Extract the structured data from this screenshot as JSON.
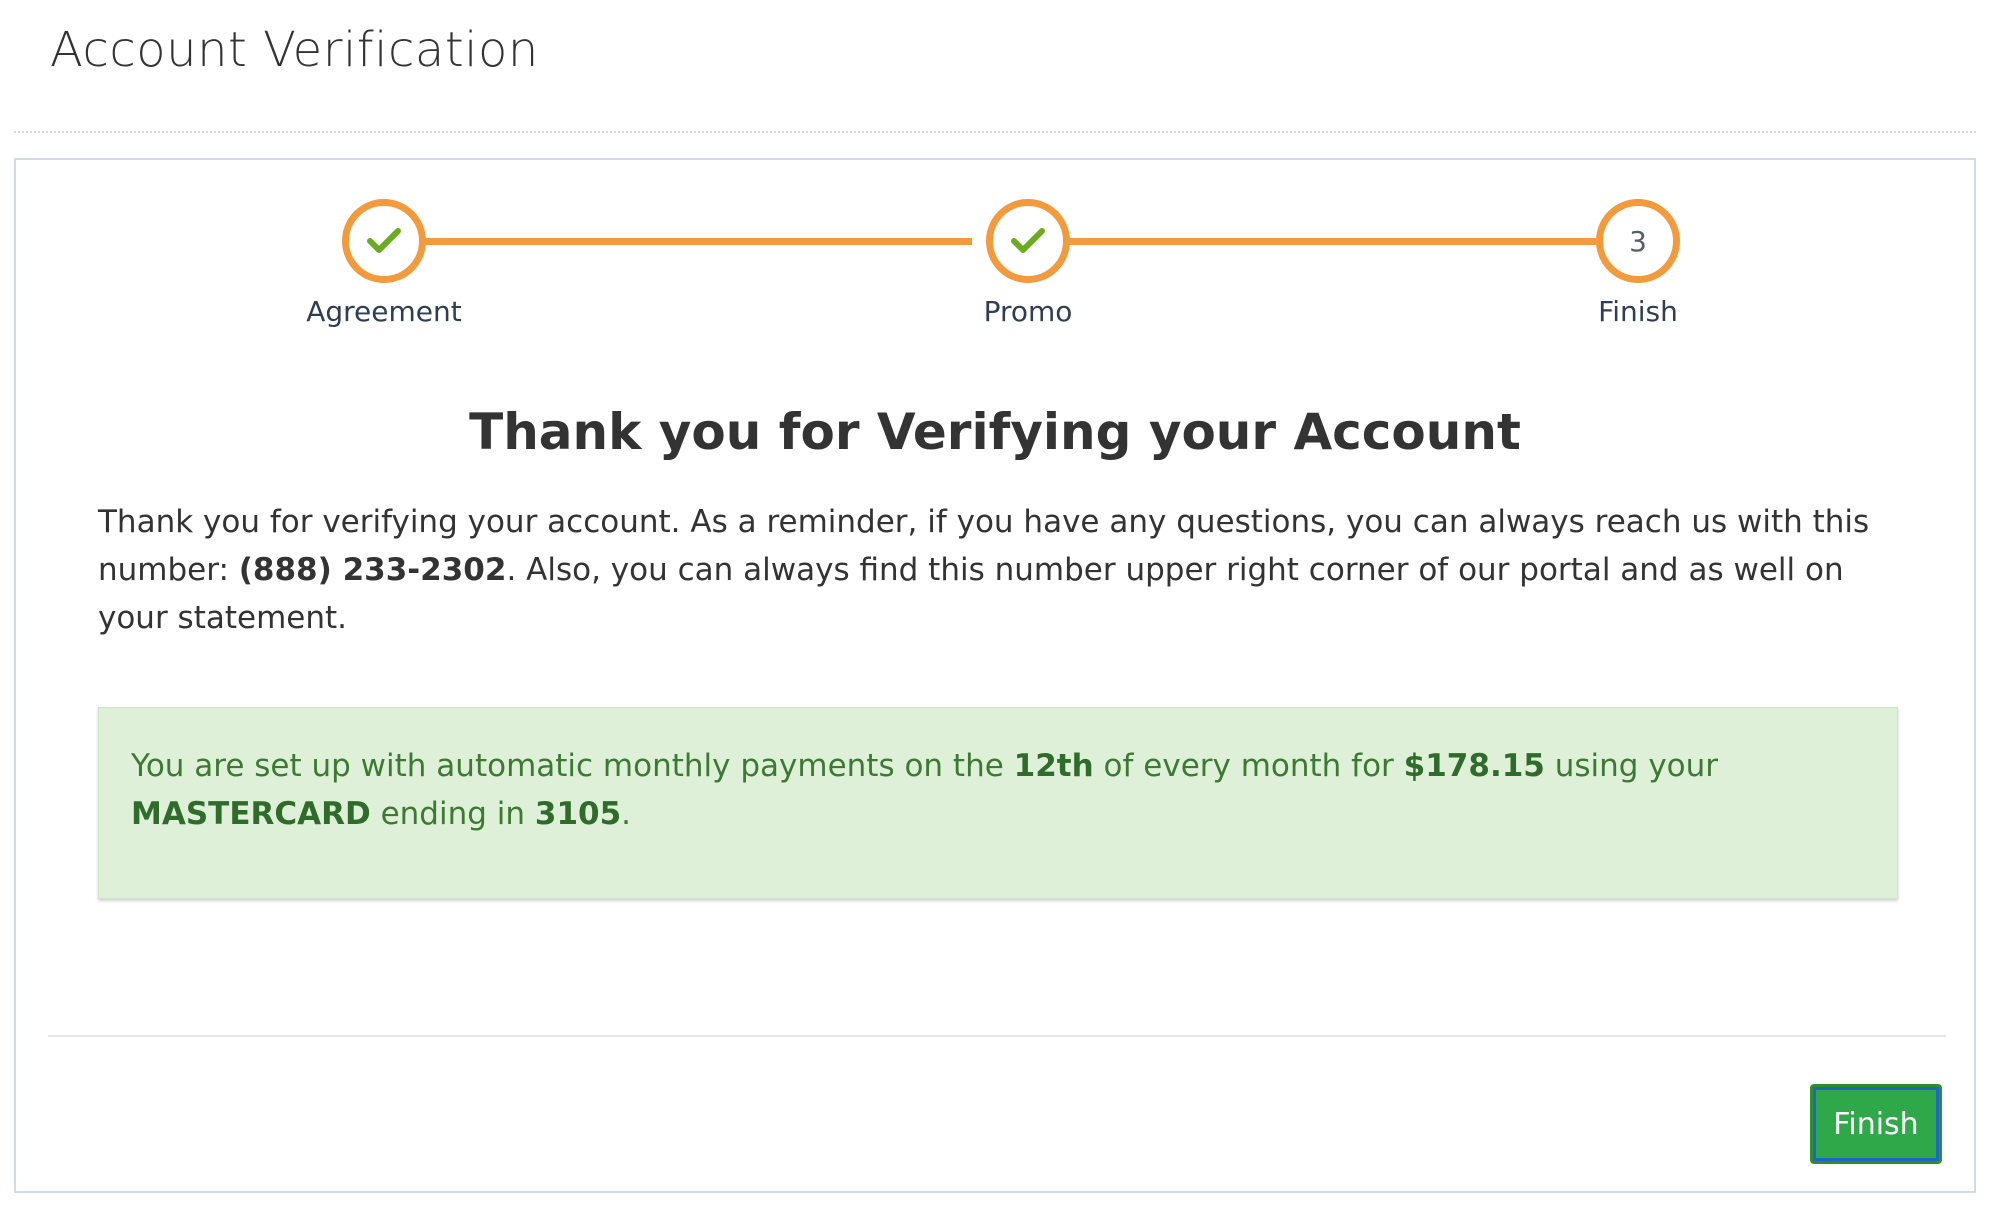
{
  "page": {
    "title": "Account Verification"
  },
  "steps": [
    {
      "label": "Agreement",
      "state": "complete",
      "icon": "check-icon"
    },
    {
      "label": "Promo",
      "state": "complete",
      "icon": "check-icon"
    },
    {
      "label": "Finish",
      "state": "current",
      "number": "3"
    }
  ],
  "content": {
    "heading": "Thank you for Verifying your Account",
    "intro_pre": "Thank you for verifying your account. As a reminder, if you have any questions, you can always reach us with this number: ",
    "phone": "(888) 233-2302",
    "intro_post": ". Also, you can always find this number upper right corner of our portal and as well on your statement."
  },
  "payment_alert": {
    "t1": "You are set up with automatic monthly payments on the ",
    "day": "12th",
    "t2": " of every month for ",
    "amount": "$178.15",
    "t3": " using your ",
    "card": "MASTERCARD",
    "t4": " ending in ",
    "last4": "3105",
    "t5": "."
  },
  "footer": {
    "finish_label": "Finish"
  },
  "colors": {
    "accent": "#f39a3d",
    "check": "#6aab1f",
    "alert_bg": "#dff0d8",
    "alert_text": "#3c7a33",
    "button": "#2fa84a"
  }
}
